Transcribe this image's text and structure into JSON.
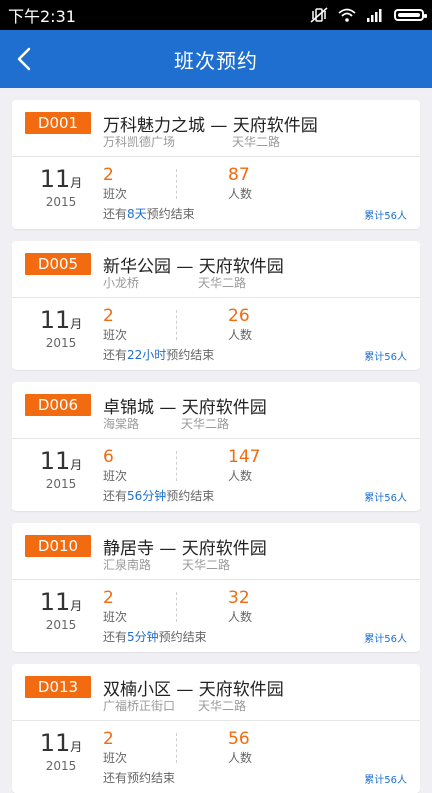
{
  "status": {
    "time": "下午2:31"
  },
  "header": {
    "title": "班次预约"
  },
  "list": [
    {
      "code": "D001",
      "route": "万科魅力之城 — 天府软件园",
      "from": "万科凯德广场",
      "to": "天华二路",
      "month": "11",
      "month_unit": "月",
      "year": "2015",
      "trips": "2",
      "trips_label": "班次",
      "people": "87",
      "people_label": "人数",
      "remain_prefix": "还有",
      "remain_time": "8天",
      "remain_suffix": "预约结束",
      "total": "累计56人"
    },
    {
      "code": "D005",
      "route": "新华公园 — 天府软件园",
      "from": "小龙桥",
      "to": "天华二路",
      "month": "11",
      "month_unit": "月",
      "year": "2015",
      "trips": "2",
      "trips_label": "班次",
      "people": "26",
      "people_label": "人数",
      "remain_prefix": "还有",
      "remain_time": "22小时",
      "remain_suffix": "预约结束",
      "total": "累计56人"
    },
    {
      "code": "D006",
      "route": "卓锦城 — 天府软件园",
      "from": "海棠路",
      "to": "天华二路",
      "month": "11",
      "month_unit": "月",
      "year": "2015",
      "trips": "6",
      "trips_label": "班次",
      "people": "147",
      "people_label": "人数",
      "remain_prefix": "还有",
      "remain_time": "56分钟",
      "remain_suffix": "预约结束",
      "total": "累计56人"
    },
    {
      "code": "D010",
      "route": "静居寺 — 天府软件园",
      "from": "汇泉南路",
      "to": "天华二路",
      "month": "11",
      "month_unit": "月",
      "year": "2015",
      "trips": "2",
      "trips_label": "班次",
      "people": "32",
      "people_label": "人数",
      "remain_prefix": "还有",
      "remain_time": "5分钟",
      "remain_suffix": "预约结束",
      "total": "累计56人"
    },
    {
      "code": "D013",
      "route": "双楠小区 — 天府软件园",
      "from": "广福桥正街口",
      "to": "天华二路",
      "month": "11",
      "month_unit": "月",
      "year": "2015",
      "trips": "2",
      "trips_label": "班次",
      "people": "56",
      "people_label": "人数",
      "remain_prefix": "还有",
      "remain_time": "",
      "remain_suffix": "预约结束",
      "total": "累计56人"
    }
  ]
}
